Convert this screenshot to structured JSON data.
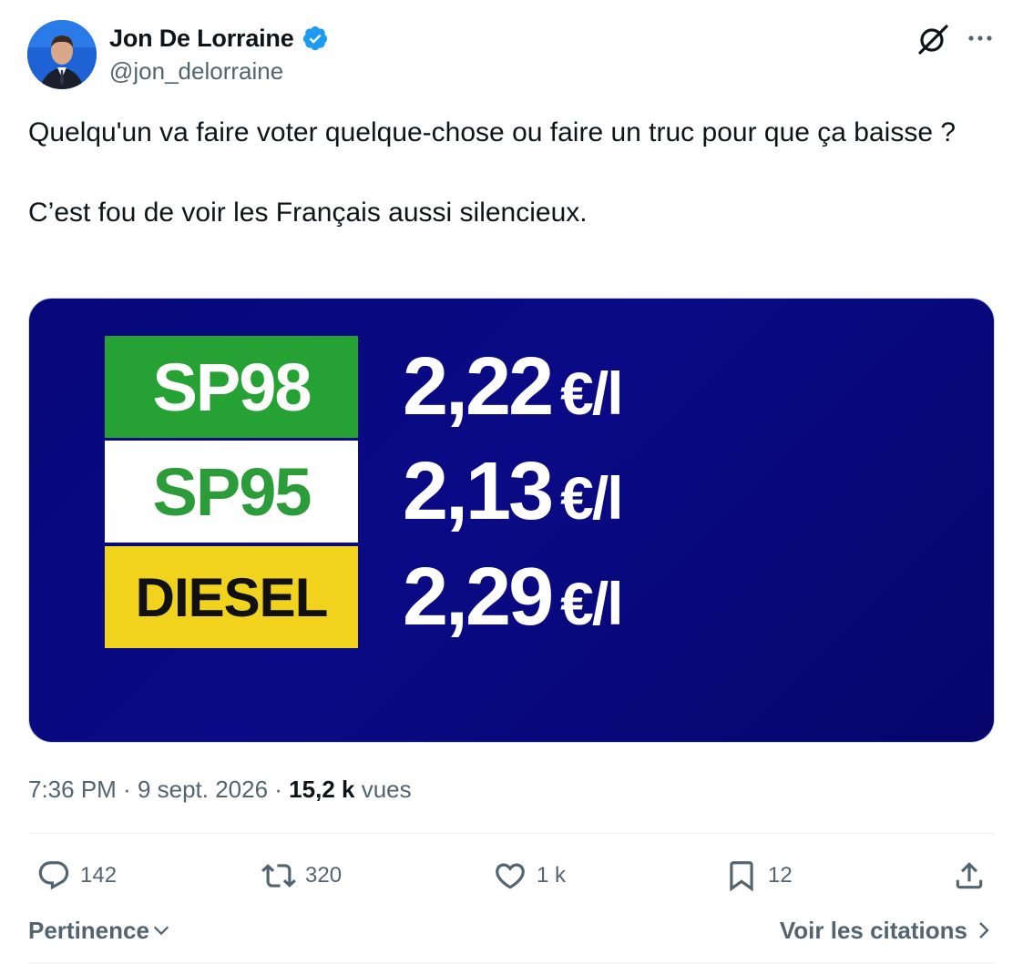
{
  "author": {
    "display_name": "Jon De Lorraine",
    "handle": "@jon_delorraine",
    "verified": true
  },
  "tweet": {
    "paragraphs": [
      "Quelqu'un va faire voter quelque-chose ou faire un truc pour que ça baisse ?",
      "C’est fou de voir les Français aussi silencieux."
    ]
  },
  "media": {
    "rows": [
      {
        "label": "SP98",
        "price": "2,22",
        "unit": "€/l"
      },
      {
        "label": "SP95",
        "price": "2,13",
        "unit": "€/l"
      },
      {
        "label": "DIESEL",
        "price": "2,29",
        "unit": "€/l"
      }
    ],
    "colors": {
      "background": "#07077a",
      "sp98": "#26a234",
      "sp95": "#ffffff",
      "diesel": "#f1d21d"
    }
  },
  "meta": {
    "time": "7:36 PM",
    "separator": " · ",
    "date": "9 sept. 2026",
    "views_count": "15,2 k",
    "views_label": " vues"
  },
  "actions": {
    "replies": "142",
    "reposts": "320",
    "likes": "1 k",
    "bookmarks": "12"
  },
  "footer": {
    "sort_label": "Pertinence",
    "quotes_label": "Voir les citations"
  },
  "icons": [
    "verified-badge-icon",
    "grok-icon",
    "more-icon",
    "reply-icon",
    "repost-icon",
    "like-icon",
    "bookmark-icon",
    "share-icon",
    "chevron-down-icon",
    "chevron-right-icon"
  ]
}
